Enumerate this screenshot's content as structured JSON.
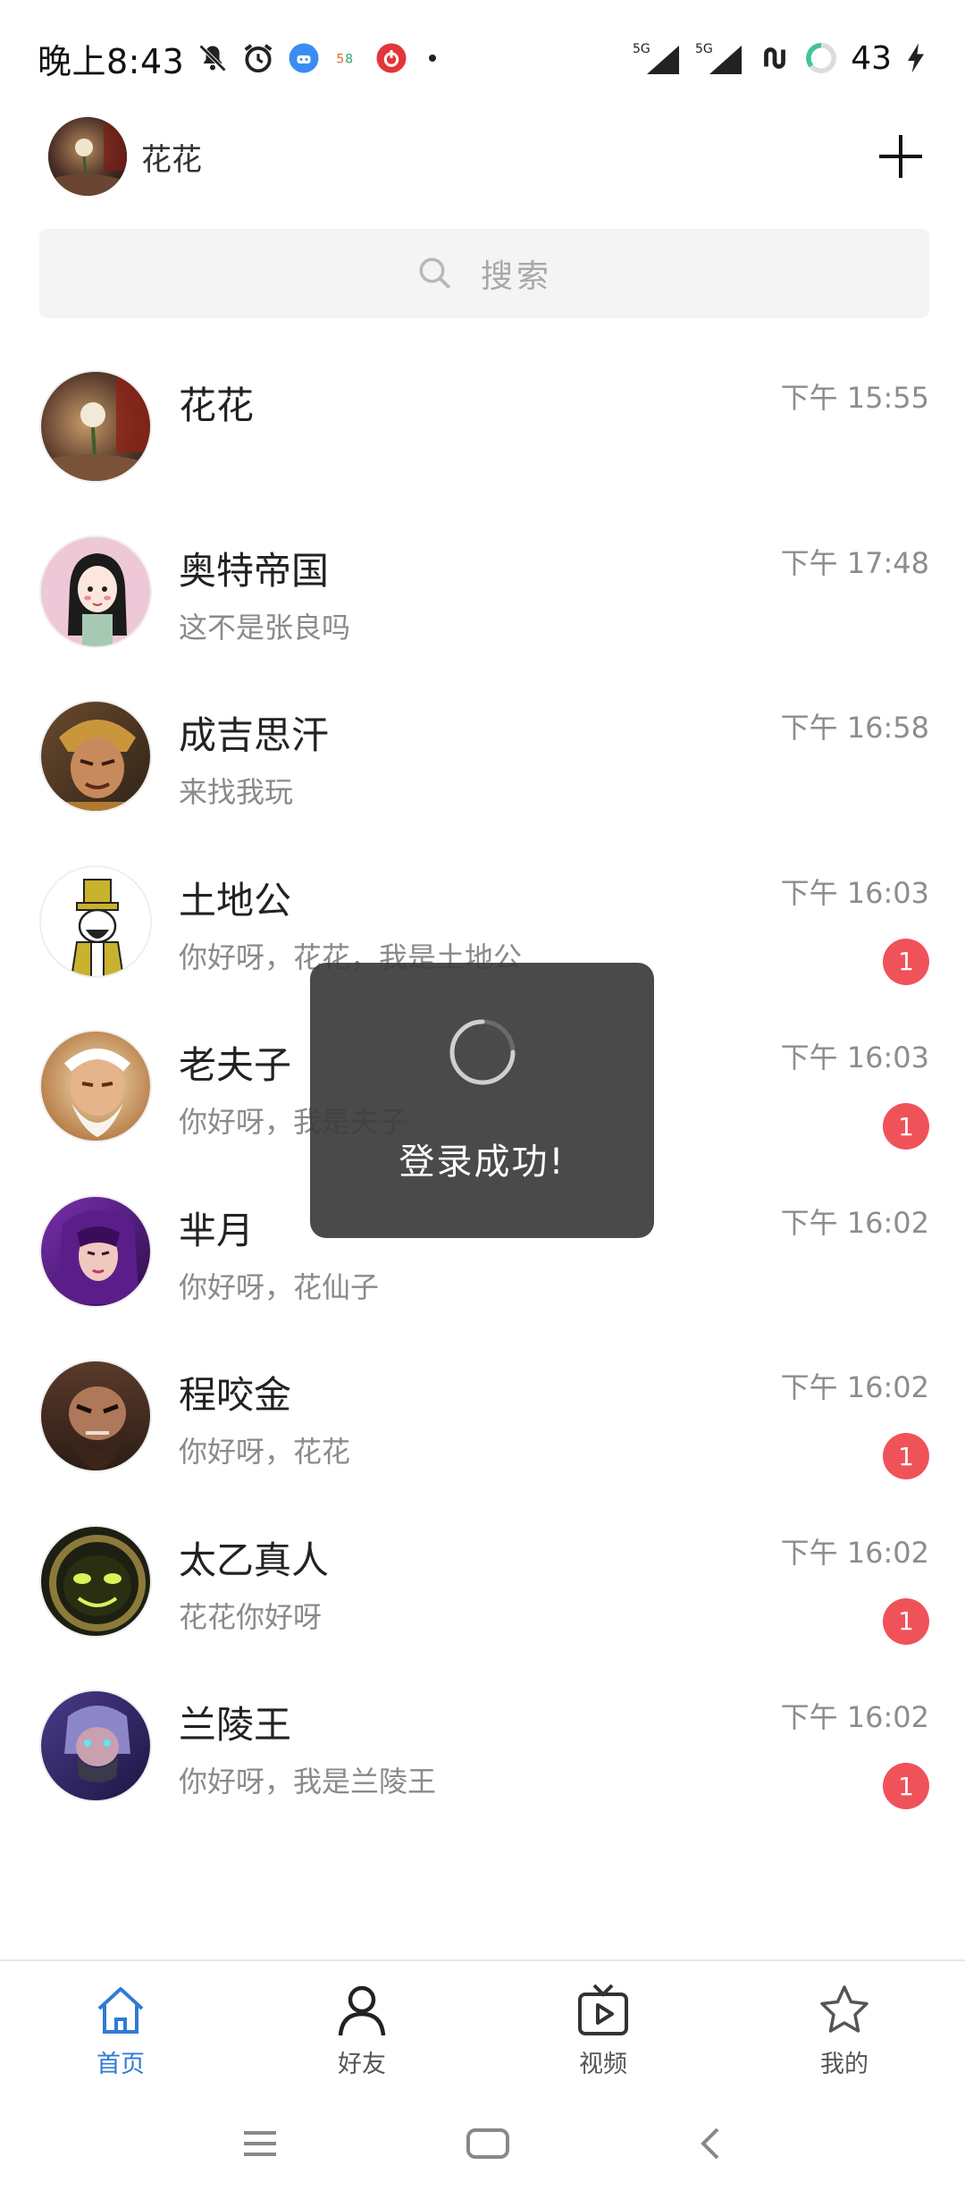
{
  "status_bar": {
    "time": "晚上8:43",
    "battery": "43",
    "icons": [
      "mute-bell-icon",
      "alarm-icon",
      "app-notify-icon-1",
      "app-notify-icon-2",
      "netease-music-icon",
      "more-dot-icon",
      "signal-5g-icon",
      "signal-5g-icon",
      "link-icon",
      "battery-ring-icon",
      "charging-icon"
    ]
  },
  "header": {
    "user_name": "花花",
    "add_icon": "plus-icon"
  },
  "search": {
    "placeholder": "搜索",
    "icon": "search-icon"
  },
  "chats": [
    {
      "name": "花花",
      "message": "",
      "time": "下午 15:55",
      "badge": ""
    },
    {
      "name": "奥特帝国",
      "message": "这不是张良吗",
      "time": "下午 17:48",
      "badge": ""
    },
    {
      "name": "成吉思汗",
      "message": "来找我玩",
      "time": "下午 16:58",
      "badge": ""
    },
    {
      "name": "土地公",
      "message": "你好呀，花花，我是土地公",
      "time": "下午 16:03",
      "badge": "1"
    },
    {
      "name": "老夫子",
      "message": "你好呀，我是夫子",
      "time": "下午 16:03",
      "badge": "1"
    },
    {
      "name": "芈月",
      "message": "你好呀，花仙子",
      "time": "下午 16:02",
      "badge": ""
    },
    {
      "name": "程咬金",
      "message": "你好呀，花花",
      "time": "下午 16:02",
      "badge": "1"
    },
    {
      "name": "太乙真人",
      "message": "花花你好呀",
      "time": "下午 16:02",
      "badge": "1"
    },
    {
      "name": "兰陵王",
      "message": "你好呀，我是兰陵王",
      "time": "下午 16:02",
      "badge": "1"
    }
  ],
  "toast": {
    "text": "登录成功!"
  },
  "bottom_nav": {
    "items": [
      {
        "label": "首页",
        "icon": "home-icon",
        "active": true
      },
      {
        "label": "好友",
        "icon": "person-icon",
        "active": false
      },
      {
        "label": "视频",
        "icon": "tv-play-icon",
        "active": false
      },
      {
        "label": "我的",
        "icon": "star-icon",
        "active": false
      }
    ]
  },
  "colors": {
    "accent": "#2f7bd6",
    "badge": "#f0525a",
    "toast_bg": "#3c3c3c"
  }
}
